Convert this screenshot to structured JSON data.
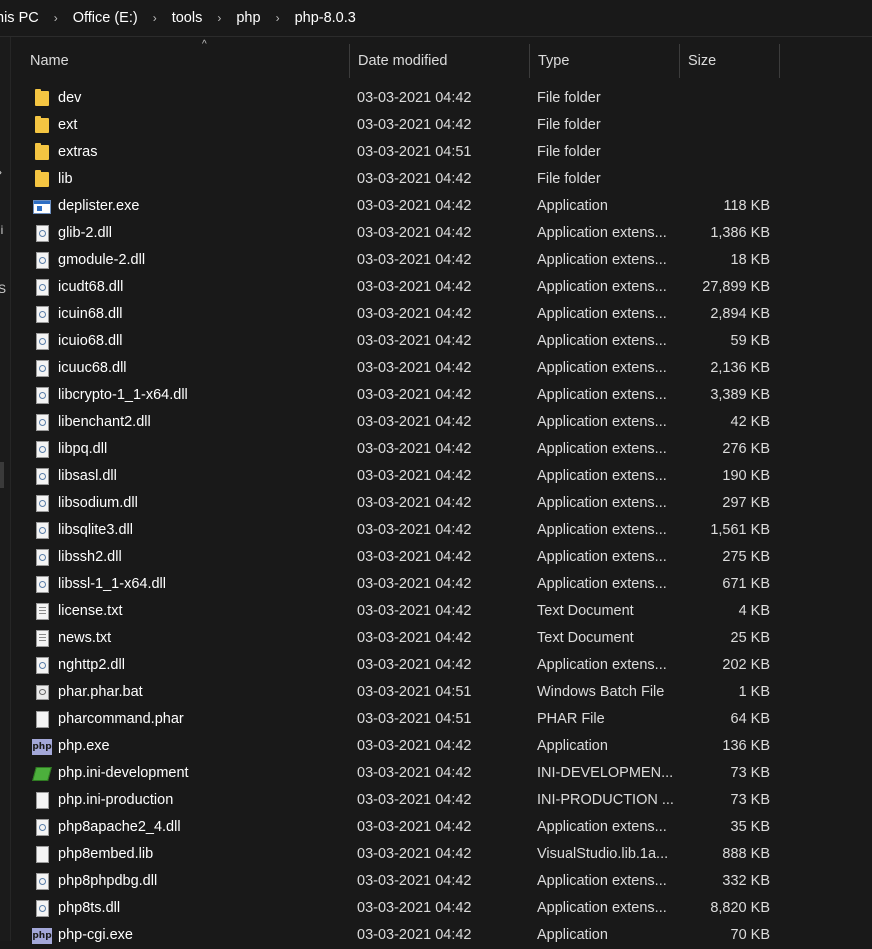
{
  "breadcrumb": [
    "his PC",
    "Office (E:)",
    "tools",
    "php",
    "php-8.0.3"
  ],
  "left_fragments": [
    "›",
    "ii",
    "S"
  ],
  "columns": {
    "name": "Name",
    "date": "Date modified",
    "type": "Type",
    "size": "Size"
  },
  "rows": [
    {
      "icon": "folder-icon",
      "name": "dev",
      "date": "03-03-2021 04:42",
      "type": "File folder",
      "size": ""
    },
    {
      "icon": "folder-icon",
      "name": "ext",
      "date": "03-03-2021 04:42",
      "type": "File folder",
      "size": ""
    },
    {
      "icon": "folder-icon",
      "name": "extras",
      "date": "03-03-2021 04:51",
      "type": "File folder",
      "size": ""
    },
    {
      "icon": "folder-icon",
      "name": "lib",
      "date": "03-03-2021 04:42",
      "type": "File folder",
      "size": ""
    },
    {
      "icon": "application-icon",
      "name": "deplister.exe",
      "date": "03-03-2021 04:42",
      "type": "Application",
      "size": "118 KB"
    },
    {
      "icon": "dll-icon",
      "name": "glib-2.dll",
      "date": "03-03-2021 04:42",
      "type": "Application extens...",
      "size": "1,386 KB"
    },
    {
      "icon": "dll-icon",
      "name": "gmodule-2.dll",
      "date": "03-03-2021 04:42",
      "type": "Application extens...",
      "size": "18 KB"
    },
    {
      "icon": "dll-icon",
      "name": "icudt68.dll",
      "date": "03-03-2021 04:42",
      "type": "Application extens...",
      "size": "27,899 KB"
    },
    {
      "icon": "dll-icon",
      "name": "icuin68.dll",
      "date": "03-03-2021 04:42",
      "type": "Application extens...",
      "size": "2,894 KB"
    },
    {
      "icon": "dll-icon",
      "name": "icuio68.dll",
      "date": "03-03-2021 04:42",
      "type": "Application extens...",
      "size": "59 KB"
    },
    {
      "icon": "dll-icon",
      "name": "icuuc68.dll",
      "date": "03-03-2021 04:42",
      "type": "Application extens...",
      "size": "2,136 KB"
    },
    {
      "icon": "dll-icon",
      "name": "libcrypto-1_1-x64.dll",
      "date": "03-03-2021 04:42",
      "type": "Application extens...",
      "size": "3,389 KB"
    },
    {
      "icon": "dll-icon",
      "name": "libenchant2.dll",
      "date": "03-03-2021 04:42",
      "type": "Application extens...",
      "size": "42 KB"
    },
    {
      "icon": "dll-icon",
      "name": "libpq.dll",
      "date": "03-03-2021 04:42",
      "type": "Application extens...",
      "size": "276 KB"
    },
    {
      "icon": "dll-icon",
      "name": "libsasl.dll",
      "date": "03-03-2021 04:42",
      "type": "Application extens...",
      "size": "190 KB"
    },
    {
      "icon": "dll-icon",
      "name": "libsodium.dll",
      "date": "03-03-2021 04:42",
      "type": "Application extens...",
      "size": "297 KB"
    },
    {
      "icon": "dll-icon",
      "name": "libsqlite3.dll",
      "date": "03-03-2021 04:42",
      "type": "Application extens...",
      "size": "1,561 KB"
    },
    {
      "icon": "dll-icon",
      "name": "libssh2.dll",
      "date": "03-03-2021 04:42",
      "type": "Application extens...",
      "size": "275 KB"
    },
    {
      "icon": "dll-icon",
      "name": "libssl-1_1-x64.dll",
      "date": "03-03-2021 04:42",
      "type": "Application extens...",
      "size": "671 KB"
    },
    {
      "icon": "text-document-icon",
      "name": "license.txt",
      "date": "03-03-2021 04:42",
      "type": "Text Document",
      "size": "4 KB"
    },
    {
      "icon": "text-document-icon",
      "name": "news.txt",
      "date": "03-03-2021 04:42",
      "type": "Text Document",
      "size": "25 KB"
    },
    {
      "icon": "dll-icon",
      "name": "nghttp2.dll",
      "date": "03-03-2021 04:42",
      "type": "Application extens...",
      "size": "202 KB"
    },
    {
      "icon": "batch-file-icon",
      "name": "phar.phar.bat",
      "date": "03-03-2021 04:51",
      "type": "Windows Batch File",
      "size": "1 KB"
    },
    {
      "icon": "blank-file-icon",
      "name": "pharcommand.phar",
      "date": "03-03-2021 04:51",
      "type": "PHAR File",
      "size": "64 KB"
    },
    {
      "icon": "php-icon",
      "name": "php.exe",
      "date": "03-03-2021 04:42",
      "type": "Application",
      "size": "136 KB"
    },
    {
      "icon": "book-icon",
      "name": "php.ini-development",
      "date": "03-03-2021 04:42",
      "type": "INI-DEVELOPMEN...",
      "size": "73 KB"
    },
    {
      "icon": "blank-file-icon",
      "name": "php.ini-production",
      "date": "03-03-2021 04:42",
      "type": "INI-PRODUCTION ...",
      "size": "73 KB"
    },
    {
      "icon": "dll-icon",
      "name": "php8apache2_4.dll",
      "date": "03-03-2021 04:42",
      "type": "Application extens...",
      "size": "35 KB"
    },
    {
      "icon": "blank-file-icon",
      "name": "php8embed.lib",
      "date": "03-03-2021 04:42",
      "type": "VisualStudio.lib.1a...",
      "size": "888 KB"
    },
    {
      "icon": "dll-icon",
      "name": "php8phpdbg.dll",
      "date": "03-03-2021 04:42",
      "type": "Application extens...",
      "size": "332 KB"
    },
    {
      "icon": "dll-icon",
      "name": "php8ts.dll",
      "date": "03-03-2021 04:42",
      "type": "Application extens...",
      "size": "8,820 KB"
    },
    {
      "icon": "php-icon",
      "name": "php-cgi.exe",
      "date": "03-03-2021 04:42",
      "type": "Application",
      "size": "70 KB"
    }
  ]
}
